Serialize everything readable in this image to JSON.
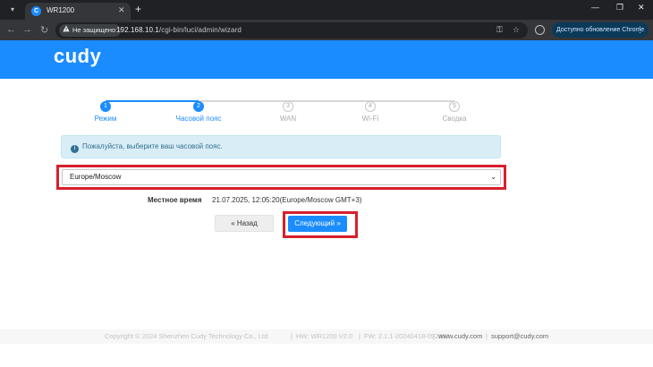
{
  "browser": {
    "tab_title": "WR1200",
    "tab_favicon_letter": "C",
    "security_label": "Не защищено",
    "url_host": "192.168.10.1",
    "url_path": "/cgi-bin/luci/admin/wizard",
    "update_button": "Доступно обновление Chrome"
  },
  "header": {
    "logo": "cudy",
    "color": "#1a8cff"
  },
  "steps": [
    {
      "number": "1",
      "label": "Режим",
      "state": "done"
    },
    {
      "number": "2",
      "label": "Часовой пояс",
      "state": "done"
    },
    {
      "number": "3",
      "label": "WAN",
      "state": "todo"
    },
    {
      "number": "4",
      "label": "Wi-Fi",
      "state": "todo"
    },
    {
      "number": "5",
      "label": "Сводка",
      "state": "todo"
    }
  ],
  "info": {
    "text": "Пожалуйста, выберите ваш часовой пояс."
  },
  "timezone_select": {
    "value": "Europe/Moscow"
  },
  "local_time": {
    "label": "Местное время",
    "value": "21.07.2025, 12:05:20(Europe/Moscow GMT+3)"
  },
  "buttons": {
    "back": "« Назад",
    "next": "Следующий »"
  },
  "footer": {
    "copyright": "Copyright © 2024 Shenzhen Cudy Technology Co., Ltd.",
    "hw": "HW: WR1200 V2.0",
    "fw": "FW: 2.1.1-20240418-092852",
    "website": "www.cudy.com",
    "email": "support@cudy.com"
  },
  "colors": {
    "accent": "#1a8cff",
    "highlight": "#d6202c"
  }
}
